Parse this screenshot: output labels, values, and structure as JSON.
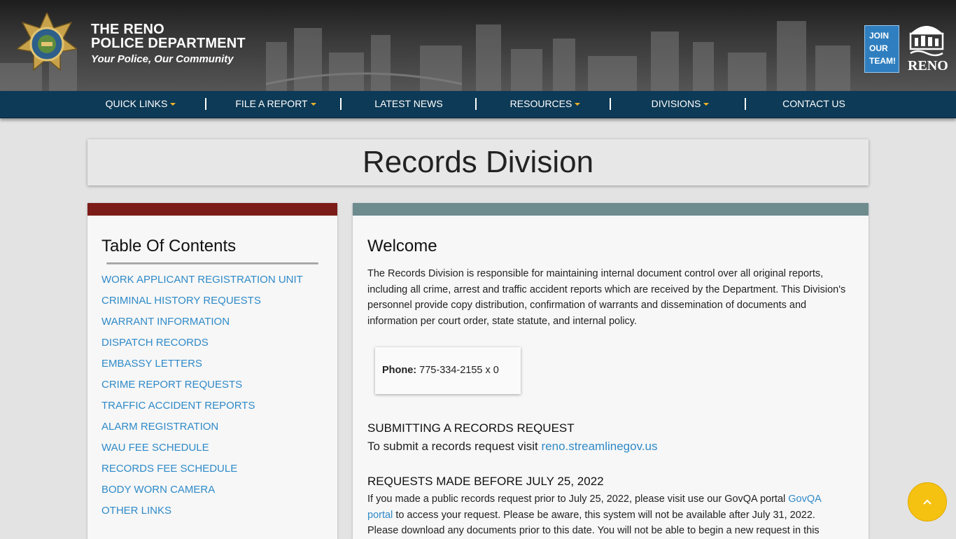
{
  "header": {
    "line1": "THE RENO",
    "line2": "POLICE DEPARTMENT",
    "tagline": "Your Police, Our Community",
    "join_label_1": "JOIN",
    "join_label_2": "OUR",
    "join_label_3": "TEAM!",
    "city_logo_text": "RENO"
  },
  "nav": {
    "items": [
      {
        "label": "QUICK LINKS",
        "icon": "caret-down-icon"
      },
      {
        "label": "FILE A REPORT",
        "icon": "caret-down-icon"
      },
      {
        "label": "LATEST NEWS"
      },
      {
        "label": "RESOURCES",
        "icon": "caret-down-icon"
      },
      {
        "label": "DIVISIONS",
        "icon": "caret-down-icon"
      },
      {
        "label": "CONTACT US"
      }
    ]
  },
  "page": {
    "title": "Records Division"
  },
  "toc": {
    "heading": "Table Of Contents",
    "items": [
      "WORK APPLICANT REGISTRATION UNIT",
      "CRIMINAL HISTORY REQUESTS",
      "WARRANT INFORMATION",
      "DISPATCH RECORDS",
      "EMBASSY LETTERS",
      "CRIME REPORT REQUESTS",
      "TRAFFIC ACCIDENT REPORTS",
      "ALARM REGISTRATION",
      "WAU FEE SCHEDULE",
      "RECORDS FEE SCHEDULE",
      "BODY WORN CAMERA",
      "OTHER LINKS"
    ]
  },
  "main": {
    "heading": "Welcome",
    "intro": "The Records Division is responsible for maintaining internal document control over all original reports, including all crime, arrest and traffic accident reports which are received by the Department. This Division's personnel provide copy distribution, confirmation of warrants and dissemination of documents and information per court order, state statute, and internal policy.",
    "phone_label": "Phone:",
    "phone_value": "775-334-2155 x 0",
    "submit_heading": "SUBMITTING A RECORDS REQUEST",
    "submit_text": "To submit a records request visit",
    "submit_link": "reno.streamlinegov.us",
    "before_heading": "REQUESTS MADE BEFORE JULY 25, 2022",
    "before_text_1": "If you made a public records request prior to July 25, 2022, please visit use our GovQA portal",
    "before_link": "GovQA portal",
    "before_text_2": "to access your request. Please be aware, this system will not be available after July 31, 2022. Please download any documents prior to this date. You will not be able to begin a new request in this"
  },
  "colors": {
    "nav_bg": "#0d3a56",
    "toc_bar": "#7c1c19",
    "main_bar": "#6e8b8e",
    "link": "#2f8ac8",
    "accent": "#f0b429",
    "to_top": "#f5c211"
  },
  "scroll_top": {
    "icon": "chevron-up-icon"
  }
}
